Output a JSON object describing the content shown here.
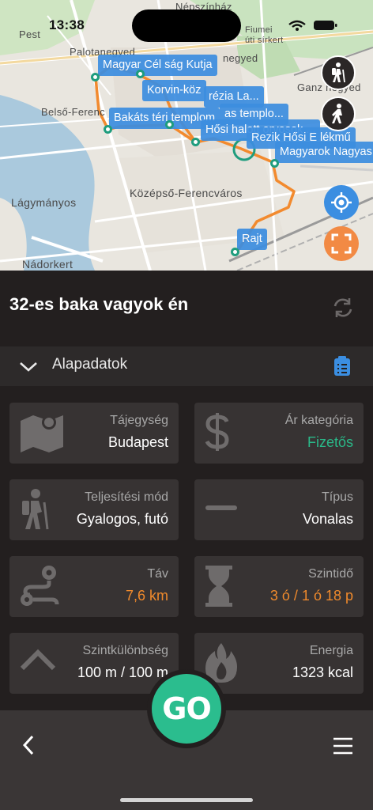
{
  "status_bar": {
    "time": "13:38"
  },
  "map": {
    "labels": [
      "Népszínház",
      "Pest",
      "Palotanegyed",
      "negyed",
      "Fiumei",
      "úti sírkert",
      "Belső-Ferenc",
      "Ganz negyed",
      "Középső-Ferencváros",
      "Lágymányos",
      "Nádorkert"
    ],
    "pois": [
      "Magyar Cél  ság Kutja",
      "Korvin-köz",
      "rézia La...",
      "as templo...",
      "Bakáts téri templom",
      "Hősi halott orvosok ...",
      "Rezik Hősi E  lékmű",
      "Magyarok Nagyas",
      "Rajt"
    ],
    "buttons": {
      "hiking": "hiker-icon",
      "walking": "walker-icon",
      "locate": "locate-icon",
      "fullscreen": "fullscreen-icon"
    }
  },
  "route": {
    "title": "32-es baka vagyok én"
  },
  "section": {
    "label": "Alapadatok"
  },
  "cards": [
    {
      "key": "Tájegység",
      "value": "Budapest",
      "icon": "map-icon"
    },
    {
      "key": "Ár kategória",
      "value": "Fizetős",
      "icon": "dollar-icon",
      "value_color": "#2ab888"
    },
    {
      "key": "Teljesítési mód",
      "value": "Gyalogos, futó",
      "icon": "hiker-icon"
    },
    {
      "key": "Típus",
      "value": "Vonalas",
      "icon": "line-icon"
    },
    {
      "key": "Táv",
      "value": "7,6 km",
      "icon": "route-icon",
      "value_color": "#f08a2c"
    },
    {
      "key": "Szintidő",
      "value": "3 ó / 1 ó 18 p",
      "icon": "hourglass-icon",
      "value_color": "#f08a2c"
    },
    {
      "key": "Szintkülönbség",
      "value": "100 m / 100 m",
      "icon": "elevation-icon"
    },
    {
      "key": "Energia",
      "value": "1323 kcal",
      "icon": "flame-icon"
    }
  ],
  "bottom": {
    "go_label": "GO"
  },
  "colors": {
    "accent_green": "#2bbd8e",
    "accent_orange": "#f08a2c",
    "map_blue": "#3b8ee1",
    "background": "#231f1f"
  }
}
